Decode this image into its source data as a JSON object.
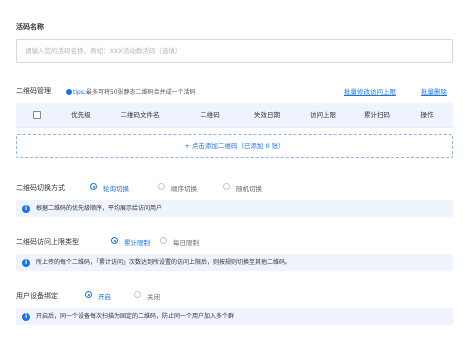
{
  "campaign_name": {
    "label": "活码名称",
    "placeholder": "请输入您的活码名称，例如：XXX活动群活码（选填）",
    "value": ""
  },
  "qr_management": {
    "label": "二维码管理",
    "tip_icon": "location-pin-icon",
    "tip_prefix": "tips:",
    "tip_text": "最多可将50张静态二维码合并成一个活码",
    "batch_edit_link": "批量修改访问上限",
    "batch_delete_link": "批量删除",
    "columns": [
      "优先级",
      "二维码文件名",
      "二维码",
      "失效日期",
      "访问上限",
      "累计扫码",
      "操作"
    ],
    "add_row_text": "+ 点击添加二维码（已添加 0 张）"
  },
  "switch_mode": {
    "label": "二维码切换方式",
    "options": [
      {
        "label": "轮询切换",
        "selected": true
      },
      {
        "label": "顺序切换",
        "selected": false
      },
      {
        "label": "随机切换",
        "selected": false
      }
    ],
    "info": "根据二维码的优先级顺序，平均展示给访问用户"
  },
  "access_limit": {
    "label": "二维码访问上限类型",
    "options": [
      {
        "label": "累计限制",
        "selected": true
      },
      {
        "label": "每日限制",
        "selected": false
      }
    ],
    "info": "所上传的每个二维码，「累计访问」次数达到所设置的访问上限后，则按规则切换至其他二维码。"
  },
  "device_binding": {
    "label": "用户设备绑定",
    "options": [
      {
        "label": "开启",
        "selected": true
      },
      {
        "label": "关闭",
        "selected": false
      }
    ],
    "info": "开启后，同一个设备每次扫描为固定的二维码，防止同一个用户加入多个群"
  },
  "colors": {
    "accent": "#1a73e8",
    "info_bg": "#eef3fd",
    "table_header_bg": "#eef3fd"
  }
}
